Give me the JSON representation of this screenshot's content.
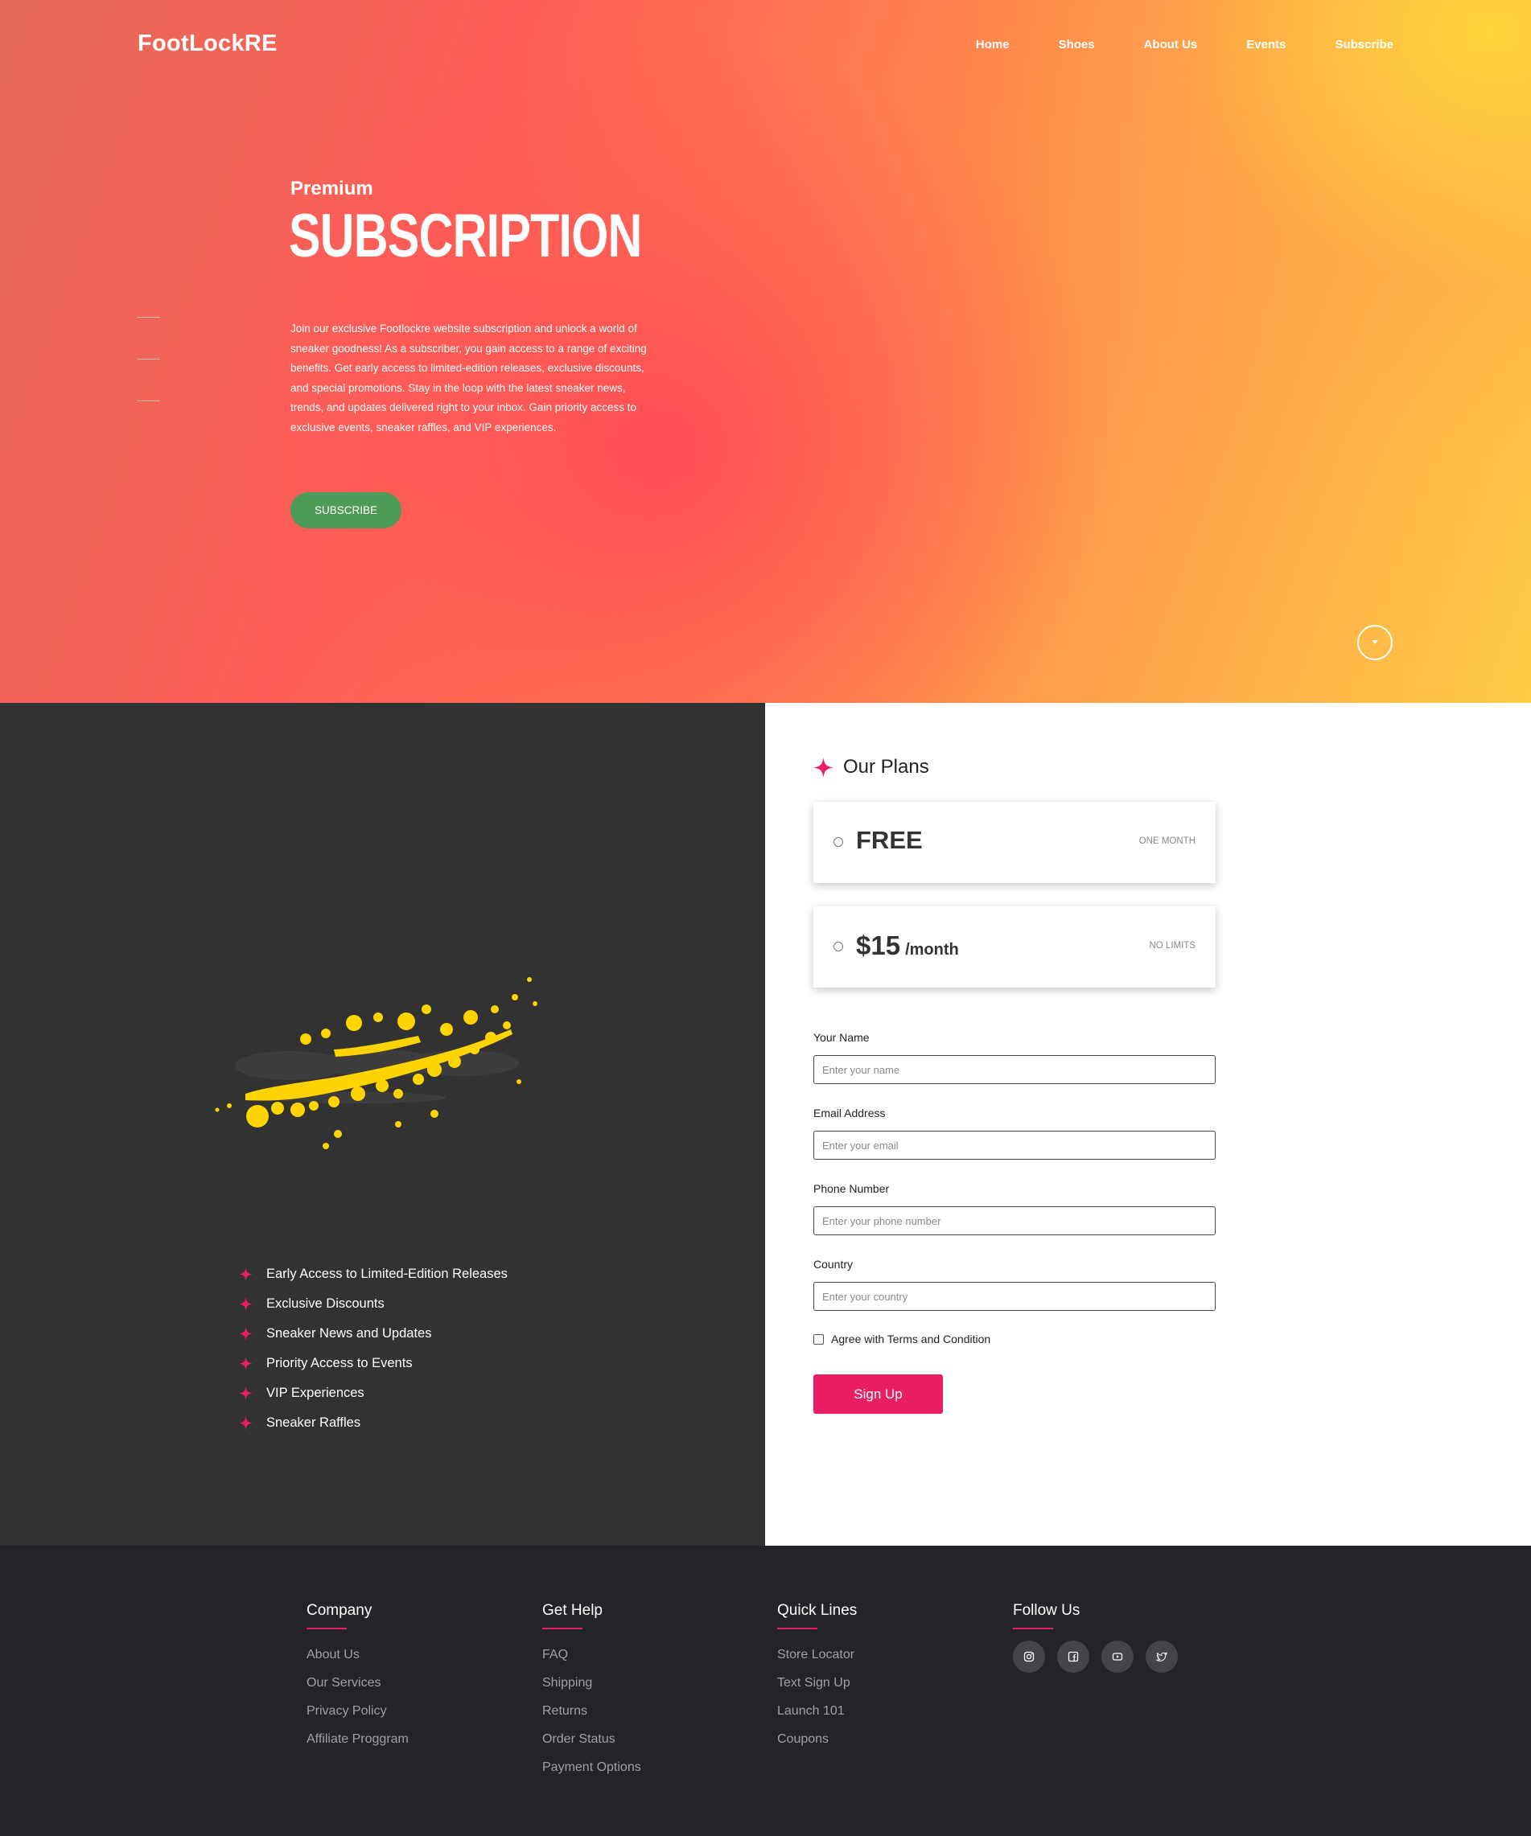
{
  "brand": {
    "name": "FootLockRE"
  },
  "nav": {
    "items": [
      "Home",
      "Shoes",
      "About Us",
      "Events",
      "Subscribe"
    ]
  },
  "hero": {
    "pre_title": "Premium",
    "title": "SUBSCRIPTION",
    "description": "Join our exclusive Footlockre website subscription and unlock a world of sneaker goodness! As a subscriber, you gain access to a range of exciting benefits. Get early access to limited-edition releases, exclusive discounts, and special promotions. Stay in the loop with the latest sneaker news, trends, and updates delivered right to your inbox. Gain priority access to exclusive events, sneaker raffles, and VIP experiences.",
    "button_label": "SUBSCRIBE"
  },
  "benefits": [
    "Early Access to Limited-Edition Releases",
    "Exclusive Discounts",
    "Sneaker News and Updates",
    "Priority Access to Events",
    "VIP Experiences",
    "Sneaker Raffles"
  ],
  "plans": {
    "heading": "Our Plans",
    "items": [
      {
        "price": "FREE",
        "per": "",
        "tag": "ONE MONTH"
      },
      {
        "price": "$15",
        "per": "/month",
        "tag": "NO LIMITS"
      }
    ]
  },
  "form": {
    "name_label": "Your Name",
    "name_placeholder": "Enter your name",
    "email_label": "Email Address",
    "email_placeholder": "Enter your email",
    "phone_label": "Phone Number",
    "phone_placeholder": "Enter your phone number",
    "country_label": "Country",
    "country_placeholder": "Enter your country",
    "terms_label": "Agree with Terms and Condition",
    "submit_label": "Sign Up"
  },
  "footer": {
    "company": {
      "heading": "Company",
      "links": [
        "About Us",
        "Our Services",
        "Privacy Policy",
        "Affiliate Proggram"
      ]
    },
    "help": {
      "heading": "Get Help",
      "links": [
        "FAQ",
        "Shipping",
        "Returns",
        "Order Status",
        "Payment Options"
      ]
    },
    "quick": {
      "heading": "Quick Lines",
      "links": [
        "Store Locator",
        "Text Sign Up",
        "Launch 101",
        "Coupons"
      ]
    },
    "follow": {
      "heading": "Follow Us",
      "icons": [
        "instagram-icon",
        "facebook-icon",
        "youtube-icon",
        "twitter-icon"
      ]
    }
  },
  "colors": {
    "accent": "#e91e63",
    "subscribe_button": "#4e9a57",
    "dark_panel": "#323232",
    "footer": "#232427"
  }
}
